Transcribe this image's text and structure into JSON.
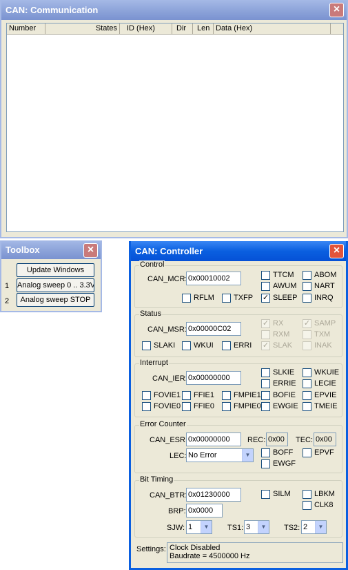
{
  "comm": {
    "title": "CAN: Communication",
    "columns": [
      "Number",
      "States",
      "ID (Hex)",
      "Dir",
      "Len",
      "Data (Hex)"
    ]
  },
  "toolbox": {
    "title": "Toolbox",
    "update": "Update Windows",
    "row1_num": "1",
    "row1_btn": "Analog sweep 0 .. 3.3V",
    "row2_num": "2",
    "row2_btn": "Analog sweep STOP"
  },
  "ctrl": {
    "title": "CAN: Controller",
    "control": {
      "group": "Control",
      "mcr_label": "CAN_MCR:",
      "mcr_value": "0x00010002",
      "ttcm": "TTCM",
      "abom": "ABOM",
      "awum": "AWUM",
      "nart": "NART",
      "rflm": "RFLM",
      "txfp": "TXFP",
      "sleep": "SLEEP",
      "inrq": "INRQ"
    },
    "status": {
      "group": "Status",
      "msr_label": "CAN_MSR:",
      "msr_value": "0x00000C02",
      "rx": "RX",
      "samp": "SAMP",
      "rxm": "RXM",
      "txm": "TXM",
      "slaki": "SLAKI",
      "wkui": "WKUI",
      "erri": "ERRI",
      "slak": "SLAK",
      "inak": "INAK"
    },
    "interrupt": {
      "group": "Interrupt",
      "ier_label": "CAN_IER:",
      "ier_value": "0x00000000",
      "slkie": "SLKIE",
      "wkuie": "WKUIE",
      "errie": "ERRIE",
      "lecie": "LECIE",
      "fovie1": "FOVIE1",
      "ffie1": "FFIE1",
      "fmpie1": "FMPIE1",
      "bofie": "BOFIE",
      "epvie": "EPVIE",
      "fovie0": "FOVIE0",
      "ffie0": "FFIE0",
      "fmpie0": "FMPIE0",
      "ewgie": "EWGIE",
      "tmeie": "TMEIE"
    },
    "error": {
      "group": "Error Counter",
      "esr_label": "CAN_ESR:",
      "esr_value": "0x00000000",
      "rec_label": "REC:",
      "rec_value": "0x00",
      "tec_label": "TEC:",
      "tec_value": "0x00",
      "lec_label": "LEC:",
      "lec_value": "No Error",
      "boff": "BOFF",
      "epvf": "EPVF",
      "ewgf": "EWGF"
    },
    "timing": {
      "group": "Bit Timing",
      "btr_label": "CAN_BTR:",
      "btr_value": "0x01230000",
      "silm": "SILM",
      "lbkm": "LBKM",
      "clk8": "CLK8",
      "brp_label": "BRP:",
      "brp_value": "0x0000",
      "sjw_label": "SJW:",
      "sjw_value": "1",
      "ts1_label": "TS1:",
      "ts1_value": "3",
      "ts2_label": "TS2:",
      "ts2_value": "2"
    },
    "settings": {
      "label": "Settings:",
      "line1": "Clock Disabled",
      "line2": "Baudrate = 4500000 Hz"
    }
  },
  "icons": {
    "close": "×",
    "check": "✓",
    "arrow": "▼"
  }
}
